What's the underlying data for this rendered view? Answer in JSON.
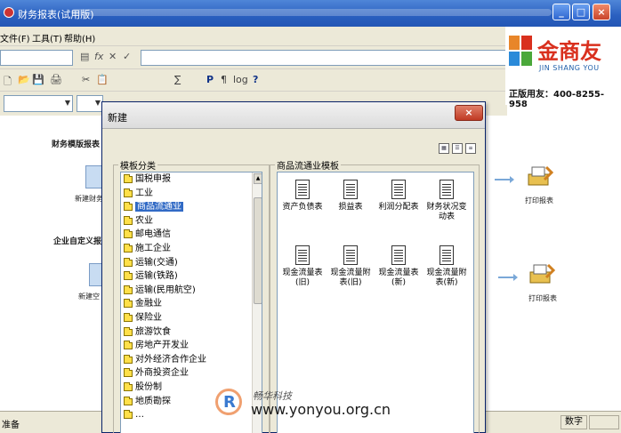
{
  "window": {
    "title": "财务报表(试用版)",
    "controls": {
      "minimize": "_",
      "maximize": "□",
      "close": "×"
    }
  },
  "menu": [
    "文件(F)",
    "工具(T)",
    "帮助(H)"
  ],
  "formula_bar": {
    "icons": [
      "cell-icon",
      "fx-icon",
      "cancel-icon",
      "confirm-icon"
    ],
    "glyphs": [
      "▤",
      "fx",
      "✕",
      "✓"
    ]
  },
  "toolbar": {
    "glyphs": [
      "🗋",
      "📂",
      "💾",
      "🖨",
      "✂",
      "📋",
      "∑",
      "P",
      "¶",
      "log",
      "?"
    ]
  },
  "brand": {
    "name": "金商友",
    "sub": "JIN SHANG YOU",
    "hotline": "正版用友：400-8255-958"
  },
  "workspace": {
    "section1": "财务模版报表",
    "section2": "企业自定义报",
    "node_new1": "新建财务",
    "node_new2": "新建空",
    "print1": "打印报表",
    "print2": "打印报表"
  },
  "dialog": {
    "title": "新建",
    "close": "×",
    "category_label": "模板分类",
    "template_label": "商品流通业模板",
    "categories": [
      "国税申报",
      "工业",
      "商品流通业",
      "农业",
      "邮电通信",
      "施工企业",
      "运输(交通)",
      "运输(铁路)",
      "运输(民用航空)",
      "金融业",
      "保险业",
      "旅游饮食",
      "房地产开发业",
      "对外经济合作企业",
      "外商投资企业",
      "股份制",
      "地质勘探",
      "…"
    ],
    "selected_category": "商品流通业",
    "templates": [
      "资产负债表",
      "损益表",
      "利润分配表",
      "财务状况变动表",
      "现金流量表(旧)",
      "现金流量附表(旧)",
      "现金流量表(新)",
      "现金流量附表(新)"
    ]
  },
  "watermark": {
    "cn": "畅华科技",
    "url": "www.yonyou.org.cn",
    "mark": "R"
  },
  "status": {
    "left": "准备",
    "num": "数字"
  },
  "colors": {
    "titlebar": "#2a5fbf",
    "selection": "#316ac5",
    "brand_red": "#d9301e"
  }
}
